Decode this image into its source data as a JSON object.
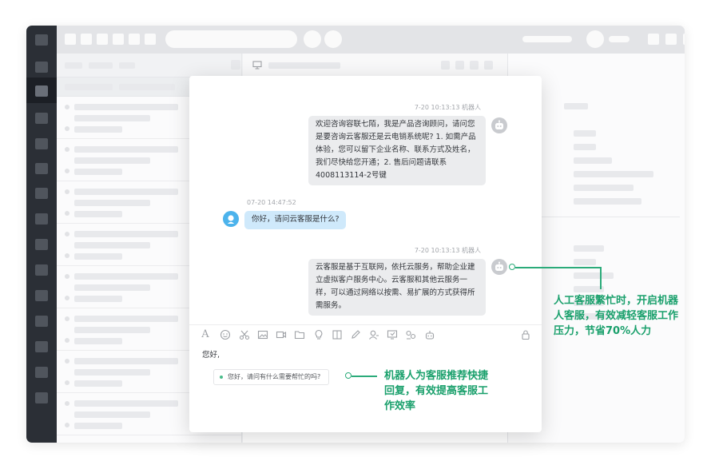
{
  "chat": {
    "msg1": {
      "meta": "7-20  10:13:13  机器人",
      "text": "欢迎咨询容联七陌，我是产品咨询顾问，请问您是要咨询云客服还是云电销系统呢? 1. 如需产品体验，您可以留下企业名称、联系方式及姓名，我们尽快给您开通；2. 售后问题请联系4008113114-2号键"
    },
    "msg2": {
      "meta": "07-20 14:47:52",
      "text": "你好，请问云客服是什么?"
    },
    "msg3": {
      "meta": "7-20  10:13:13  机器人",
      "text": "云客服是基于互联网，依托云服务，帮助企业建立虚拟客户服务中心。云客服和其他云服务一样，可以通过网络以按需、易扩展的方式获得所需服务。"
    }
  },
  "toolbar_icons": [
    "font-icon",
    "emoji-icon",
    "scissors-icon",
    "image-icon",
    "video-icon",
    "folder-icon",
    "bulb-icon",
    "book-icon",
    "edit-icon",
    "user-icon",
    "screen-icon",
    "transfer-icon",
    "robot-icon",
    "lock-icon"
  ],
  "composer": {
    "draft_text": "您好,",
    "suggestion": "您好，请问有什么需要帮忙的吗?"
  },
  "annotations": {
    "robot_assist": "人工客服繁忙时，开启机器人客服，有效减轻客服工作压力，节省70%人力",
    "quick_reply": "机器人为客服推荐快捷回复，有效提高客服工作效率"
  },
  "colors": {
    "accent": "#2bab7a",
    "robot_bubble": "#ebecee",
    "user_bubble": "#cfe9fb",
    "user_avatar": "#4cb3ec",
    "rail": "#2b2f36"
  }
}
